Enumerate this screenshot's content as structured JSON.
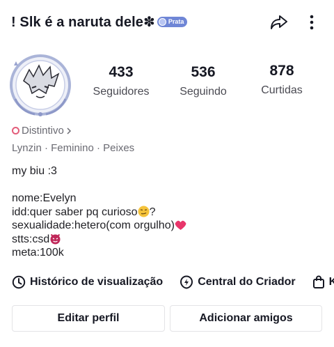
{
  "header": {
    "username": "! Slk é a naruta dele✽",
    "badge_label": "Prata",
    "share_icon": "share-arrow-icon",
    "more_icon": "more-vertical-icon"
  },
  "stats": [
    {
      "value": "433",
      "label": "Seguidores"
    },
    {
      "value": "536",
      "label": "Seguindo"
    },
    {
      "value": "878",
      "label": "Curtidas"
    }
  ],
  "profile": {
    "distintivo": "Distintivo",
    "meta": "Lynzin · Feminino · Peixes"
  },
  "bio": {
    "line1": "my biu :3",
    "line2": "nome:Evelyn",
    "line3": "idd:quer saber pq curioso",
    "line3_suffix": "?",
    "line4": "sexualidade:hetero(com orgulho)",
    "line5": "stts:csd",
    "line6": "meta:100k"
  },
  "links": [
    {
      "label": "Histórico de visualização",
      "icon": "clock-icon"
    },
    {
      "label": "Central do Criador",
      "icon": "lightning-icon"
    },
    {
      "label": "K",
      "icon": "shopping-bag-icon"
    }
  ],
  "buttons": {
    "edit": "Editar perfil",
    "add": "Adicionar amigos"
  },
  "colors": {
    "badge": "#6f86d6",
    "heart": "#e8356a",
    "distintivo_icon": "#e35d7a"
  }
}
